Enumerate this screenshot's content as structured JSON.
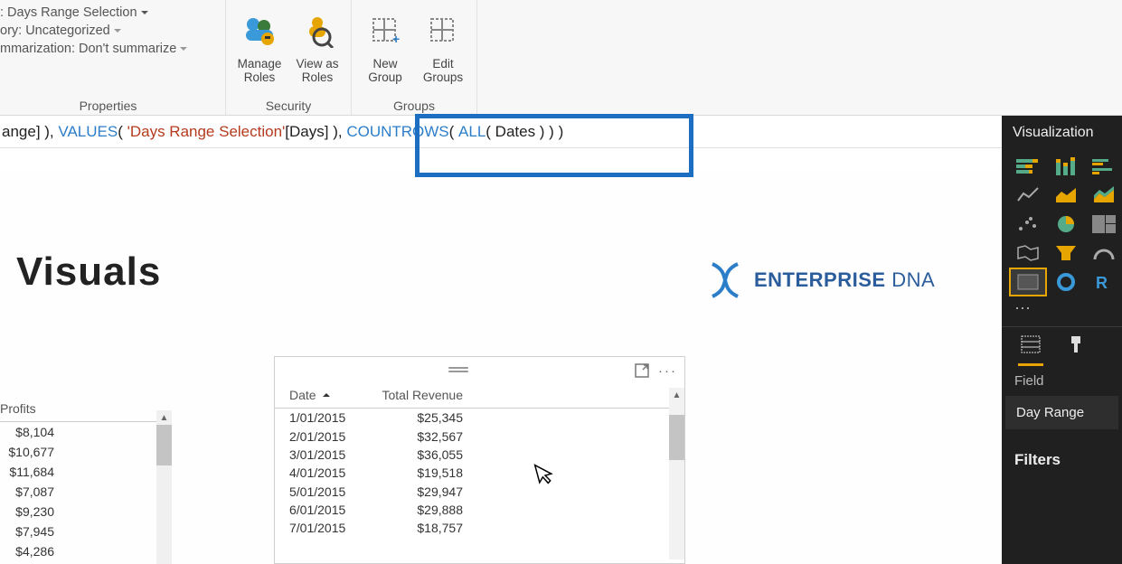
{
  "ribbon": {
    "properties": {
      "header_label": ": Days Range Selection",
      "category_label": "ory: Uncategorized",
      "summarization_label": "mmarization: Don't summarize",
      "group_label": "Properties"
    },
    "security": {
      "manage_roles_line1": "Manage",
      "manage_roles_line2": "Roles",
      "view_as_line1": "View as",
      "view_as_line2": "Roles",
      "group_label": "Security"
    },
    "groups": {
      "new_line1": "New",
      "new_line2": "Group",
      "edit_line1": "Edit",
      "edit_line2": "Groups",
      "group_label": "Groups"
    }
  },
  "formula": {
    "p1": "ange] ), ",
    "fn1": "VALUES",
    "p2": "( ",
    "str1": "'Days Range Selection'",
    "p3": "[Days] ), ",
    "fn2": "COUNTROWS",
    "p4": "( ",
    "fn3": "ALL",
    "p5": "( Dates ) ) )"
  },
  "canvas": {
    "title": "Visuals",
    "brand_a": "ENTERPRISE",
    "brand_b": " DNA"
  },
  "profits": {
    "header": "Profits",
    "rows": [
      "$8,104",
      "$10,677",
      "$11,684",
      "$7,087",
      "$9,230",
      "$7,945",
      "$4,286"
    ]
  },
  "revenue": {
    "h_date": "Date",
    "h_rev": "Total Revenue",
    "rows": [
      {
        "d": "1/01/2015",
        "v": "$25,345"
      },
      {
        "d": "2/01/2015",
        "v": "$32,567"
      },
      {
        "d": "3/01/2015",
        "v": "$36,055"
      },
      {
        "d": "4/01/2015",
        "v": "$19,518"
      },
      {
        "d": "5/01/2015",
        "v": "$29,947"
      },
      {
        "d": "6/01/2015",
        "v": "$29,888"
      },
      {
        "d": "7/01/2015",
        "v": "$18,757"
      }
    ]
  },
  "right": {
    "title": "Visualization",
    "field_label": "Field",
    "field_value": "Day Range",
    "filters_label": "Filters"
  }
}
